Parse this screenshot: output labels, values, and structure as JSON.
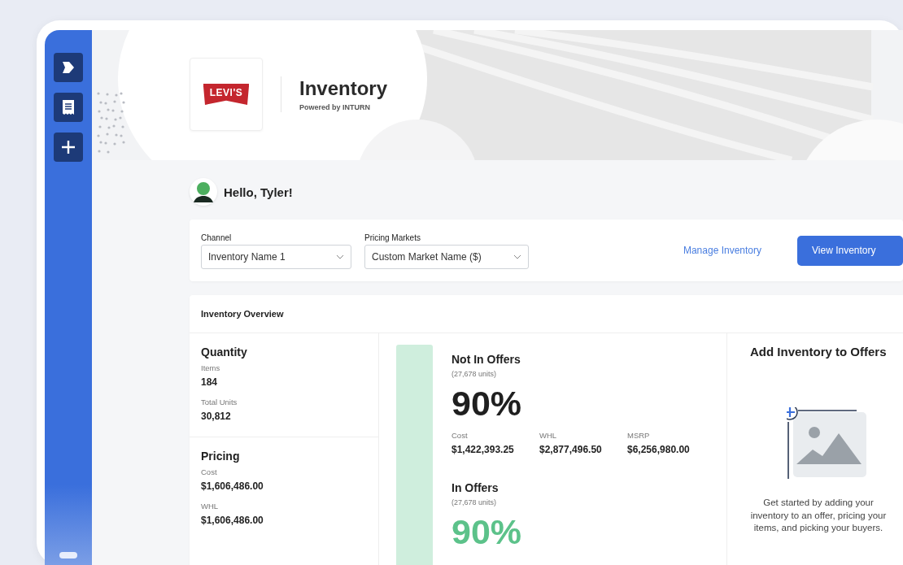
{
  "header": {
    "logo_text": "LEVI'S",
    "title": "Inventory",
    "subtitle": "Powered by INTURN"
  },
  "greeting": "Hello, Tyler!",
  "filters": [
    {
      "label": "Channel",
      "value": "Inventory Name 1"
    },
    {
      "label": "Pricing Markets",
      "value": "Custom Market Name ($)"
    }
  ],
  "actions": [
    {
      "kind": "link",
      "label": "Manage Inventory"
    },
    {
      "kind": "primary",
      "label": "View Inventory"
    }
  ],
  "overview": {
    "title": "Inventory Overview",
    "groups": [
      {
        "title": "Quantity",
        "stats": [
          {
            "label": "Items",
            "value": "184"
          },
          {
            "label": "Total Units",
            "value": "30,812"
          }
        ]
      },
      {
        "title": "Pricing",
        "stats": [
          {
            "label": "Cost",
            "value": "$1,606,486.00"
          },
          {
            "label": "WHL",
            "value": "$1,606,486.00"
          }
        ]
      }
    ],
    "segments": [
      {
        "kind": "neutral",
        "title": "Not In Offers",
        "units": "(27,678 units)",
        "percent": "90%",
        "stats": [
          {
            "label": "Cost",
            "value": "$1,422,393.25"
          },
          {
            "label": "WHL",
            "value": "$2,877,496.50"
          },
          {
            "label": "MSRP",
            "value": "$6,256,980.00"
          }
        ]
      },
      {
        "kind": "positive",
        "title": "In Offers",
        "units": "(27,678 units)",
        "percent": "90%"
      }
    ],
    "cta": {
      "title": "Add Inventory to Offers",
      "text": "Get started by adding your inventory to an offer, pricing your items, and picking your buyers."
    }
  }
}
